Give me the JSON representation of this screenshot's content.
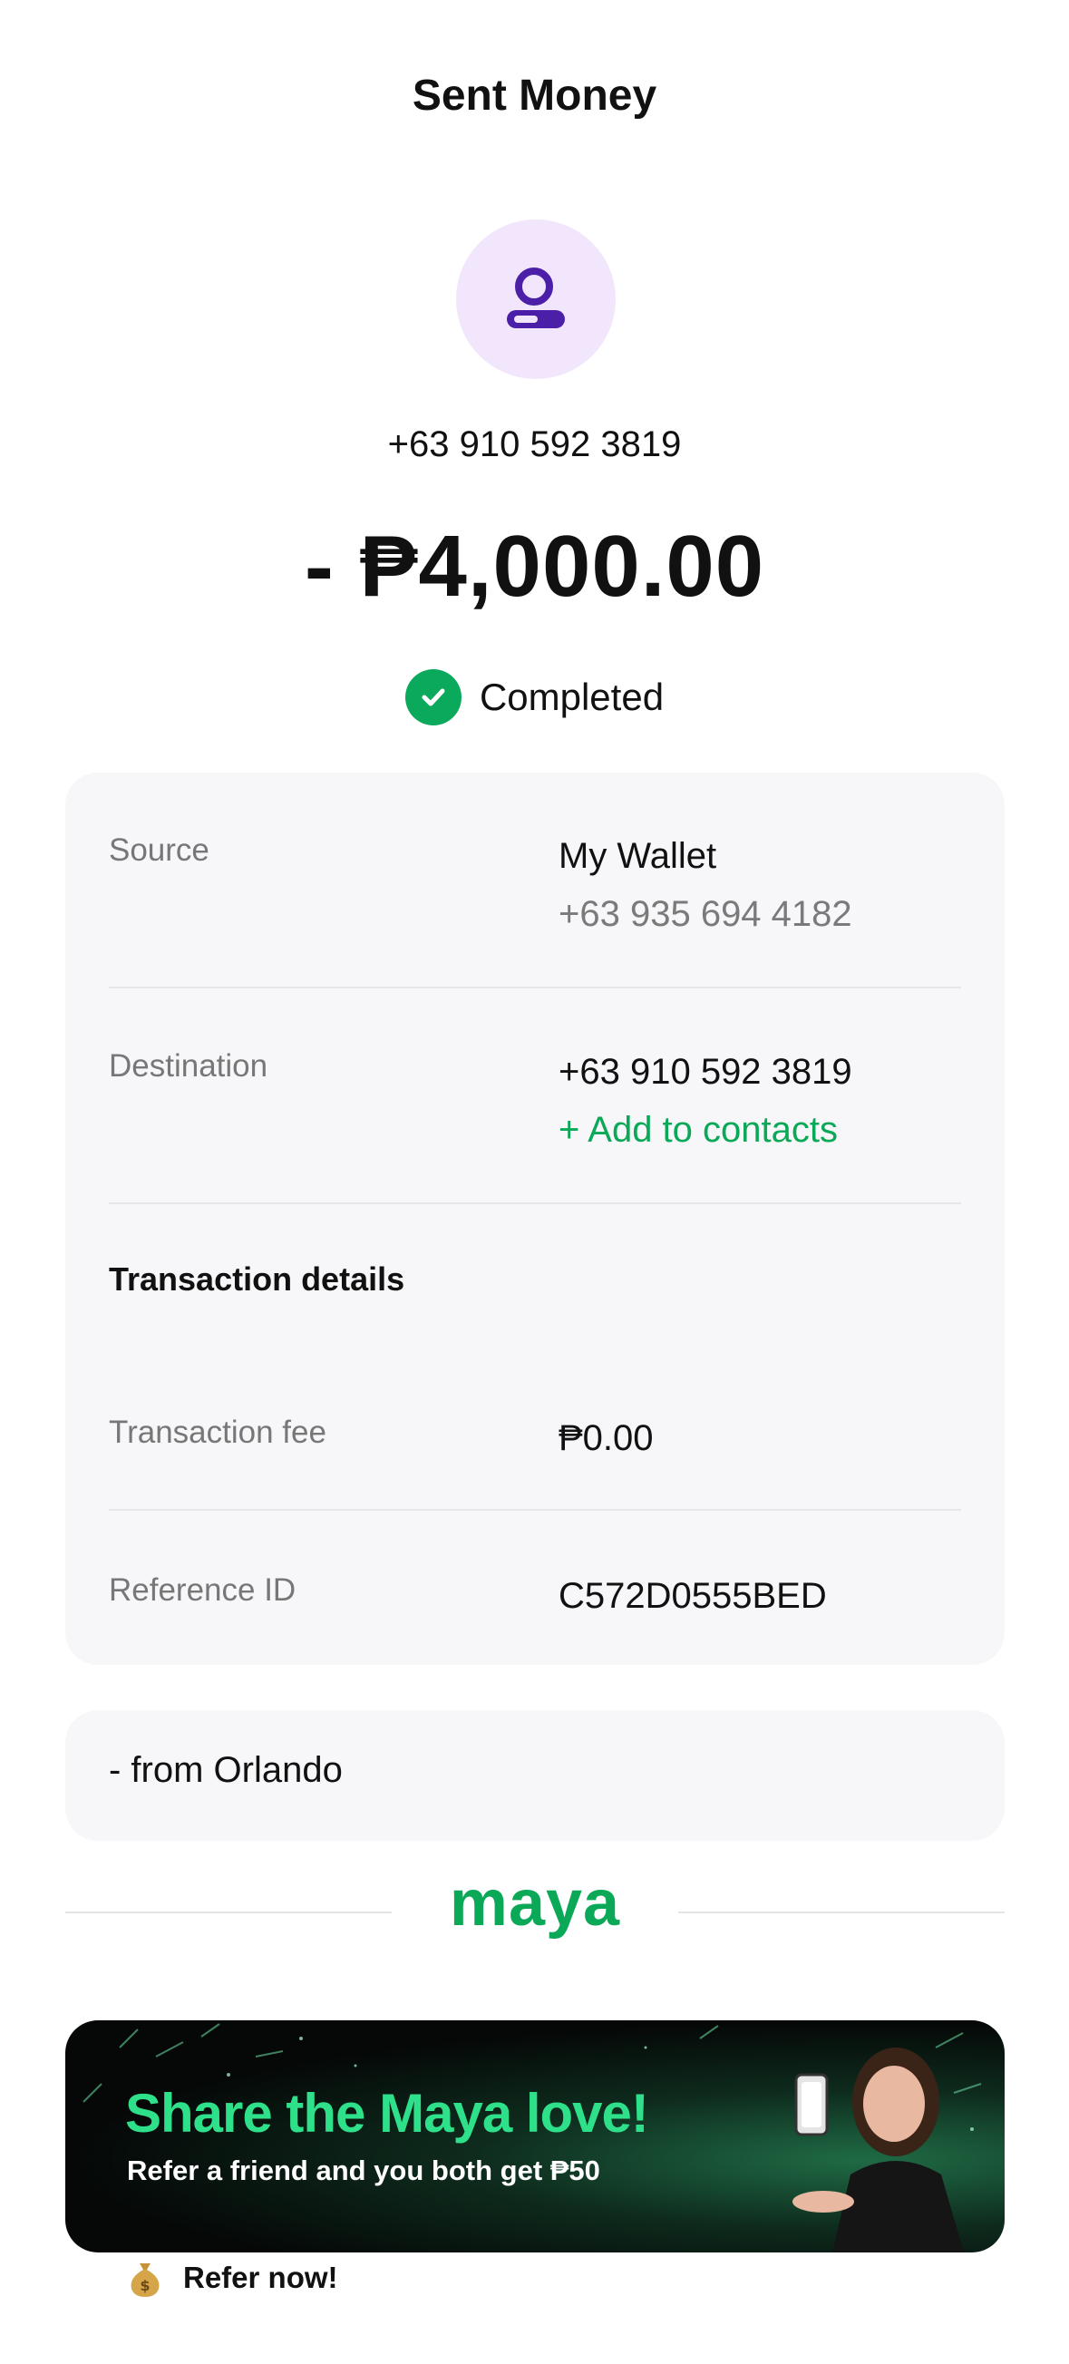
{
  "header": {
    "title": "Sent Money"
  },
  "recipient": {
    "phone": "+63 910 592 3819"
  },
  "amount": "- ₱4,000.00",
  "status": {
    "label": "Completed",
    "color": "#0ba95b"
  },
  "source": {
    "label": "Source",
    "name": "My Wallet",
    "phone": "+63 935 694 4182"
  },
  "destination": {
    "label": "Destination",
    "phone": "+63 910 592 3819",
    "add_contact": "+ Add to contacts"
  },
  "transaction": {
    "section_title": "Transaction details",
    "fee_label": "Transaction fee",
    "fee_value": "₱0.00",
    "ref_label": "Reference ID",
    "ref_value": "C572D0555BED"
  },
  "note": "- from Orlando",
  "brand": {
    "logo_text": "maya",
    "color": "#0aa857"
  },
  "promo": {
    "title": "Share the Maya love!",
    "subtitle": "Refer a friend and you both get ₱50"
  },
  "refer": {
    "label": "Refer now!",
    "icon": "money-bag-icon"
  }
}
